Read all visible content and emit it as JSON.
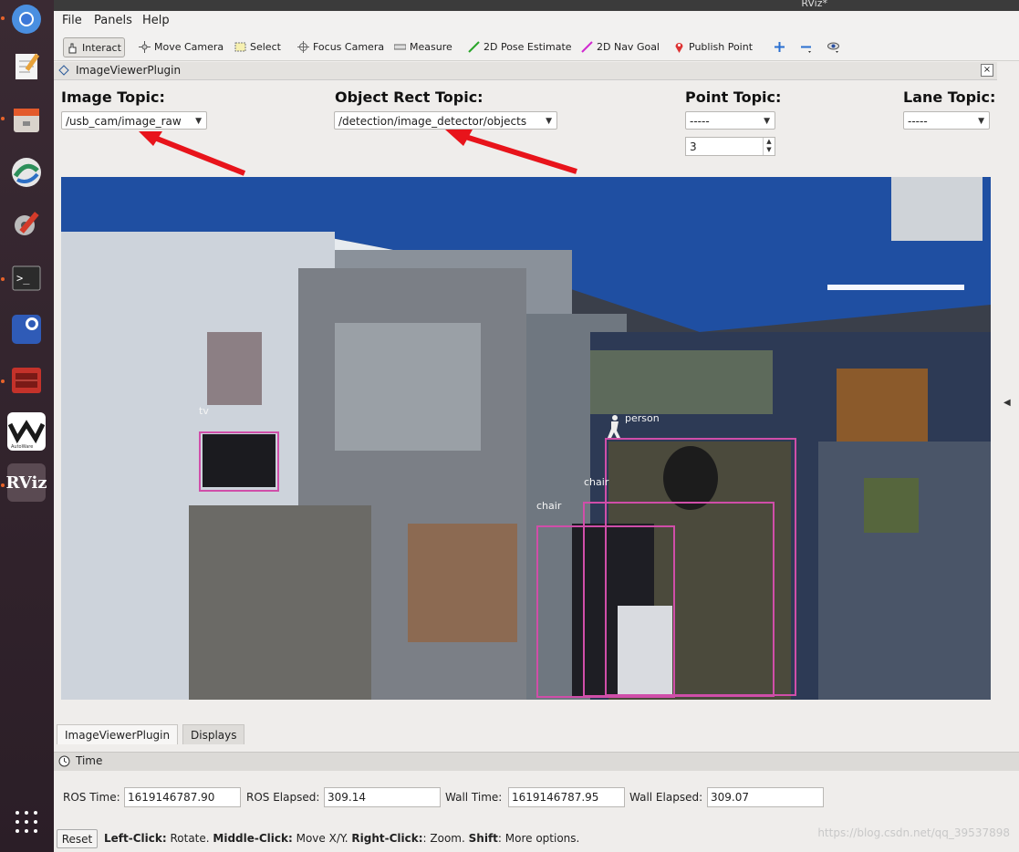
{
  "window": {
    "title": "RViz*"
  },
  "menu": {
    "file": "File",
    "panels": "Panels",
    "help": "Help"
  },
  "toolbar": {
    "interact": "Interact",
    "move_camera": "Move Camera",
    "select": "Select",
    "focus_camera": "Focus Camera",
    "measure": "Measure",
    "pose_estimate": "2D Pose Estimate",
    "nav_goal": "2D Nav Goal",
    "publish_point": "Publish Point"
  },
  "panel": {
    "title": "ImageViewerPlugin",
    "close": "×",
    "image_topic": {
      "label": "Image Topic:",
      "value": "/usb_cam/image_raw"
    },
    "object_rect_topic": {
      "label": "Object Rect Topic:",
      "value": "/detection/image_detector/objects"
    },
    "point_topic": {
      "label": "Point Topic:",
      "value": "-----",
      "spin_value": "3"
    },
    "lane_topic": {
      "label": "Lane Topic:",
      "value": "-----"
    }
  },
  "detections": {
    "tv": "tv",
    "person": "person",
    "chair1": "chair",
    "chair2": "chair"
  },
  "tabs": {
    "image_viewer": "ImageViewerPlugin",
    "displays": "Displays"
  },
  "time": {
    "title": "Time",
    "ros_time_label": "ROS Time:",
    "ros_time": "1619146787.90",
    "ros_elapsed_label": "ROS Elapsed:",
    "ros_elapsed": "309.14",
    "wall_time_label": "Wall Time:",
    "wall_time": "1619146787.95",
    "wall_elapsed_label": "Wall Elapsed:",
    "wall_elapsed": "309.07"
  },
  "footer": {
    "reset": "Reset",
    "hint_left_b": "Left-Click:",
    "hint_left": " Rotate. ",
    "hint_mid_b": "Middle-Click:",
    "hint_mid": " Move X/Y. ",
    "hint_right_b": "Right-Click:",
    "hint_right": ": Zoom. ",
    "hint_shift_b": "Shift",
    "hint_shift": ": More options."
  },
  "watermark": "https://blog.csdn.net/qq_39537898",
  "launcher": {
    "autoware_label": "AutoWare",
    "rviz_label": "RViz"
  },
  "colors": {
    "bbox": "#d04ea9",
    "arrow": "#e8141b",
    "launcher_dot": "#e8632a"
  }
}
